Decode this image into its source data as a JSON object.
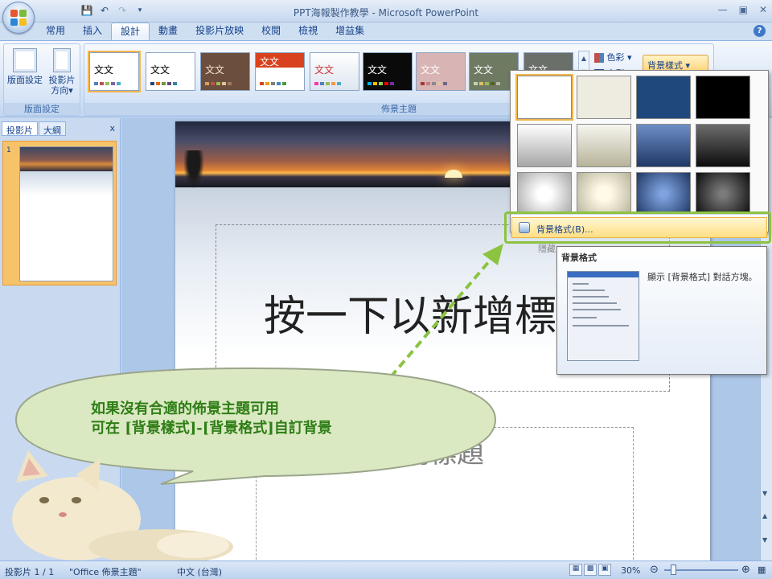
{
  "window": {
    "title": "PPT海報製作教學 - Microsoft PowerPoint"
  },
  "qat": {
    "save_icon": "save-icon",
    "undo_icon": "undo-icon",
    "redo_icon": "redo-icon"
  },
  "tabs": [
    {
      "label": "常用"
    },
    {
      "label": "插入"
    },
    {
      "label": "設計",
      "active": true
    },
    {
      "label": "動畫"
    },
    {
      "label": "投影片放映"
    },
    {
      "label": "校閱"
    },
    {
      "label": "檢視"
    },
    {
      "label": "增益集"
    }
  ],
  "ribbon": {
    "page_setup": {
      "label": "版面設定",
      "btn_page_setup": "版面設定",
      "btn_orientation_line1": "投影片",
      "btn_orientation_line2": "方向▾"
    },
    "themes": {
      "label": "佈景主題",
      "thumb_text": "文文",
      "colors_label": "色彩 ▾",
      "fonts_label": "字型",
      "bg_styles_label": "背景樣式 ▾"
    }
  },
  "left_panel": {
    "tab_slides": "投影片",
    "tab_outline": "大綱",
    "close": "x",
    "slide_number": "1"
  },
  "slide": {
    "title_placeholder": "按一下以新增標",
    "subtitle_placeholder": "以新增副標題"
  },
  "dropdown": {
    "format_item": "背景格式(B)...",
    "hide_item": "隱藏"
  },
  "tooltip": {
    "title": "背景格式",
    "body": "顯示 [背景格式] 對話方塊。"
  },
  "callout": {
    "line1": "如果沒有合適的佈景主題可用",
    "line2": "可在 [背景樣式]-[背景格式]自訂背景"
  },
  "status": {
    "slide": "投影片 1 / 1",
    "theme": "\"Office 佈景主題\"",
    "lang": "中文 (台灣)",
    "zoom": "30%"
  },
  "colors": {
    "accent_green": "#8cc341",
    "callout_fill": "#dbe9c3",
    "callout_text": "#2e7d16",
    "selection_orange": "#f4b550"
  }
}
